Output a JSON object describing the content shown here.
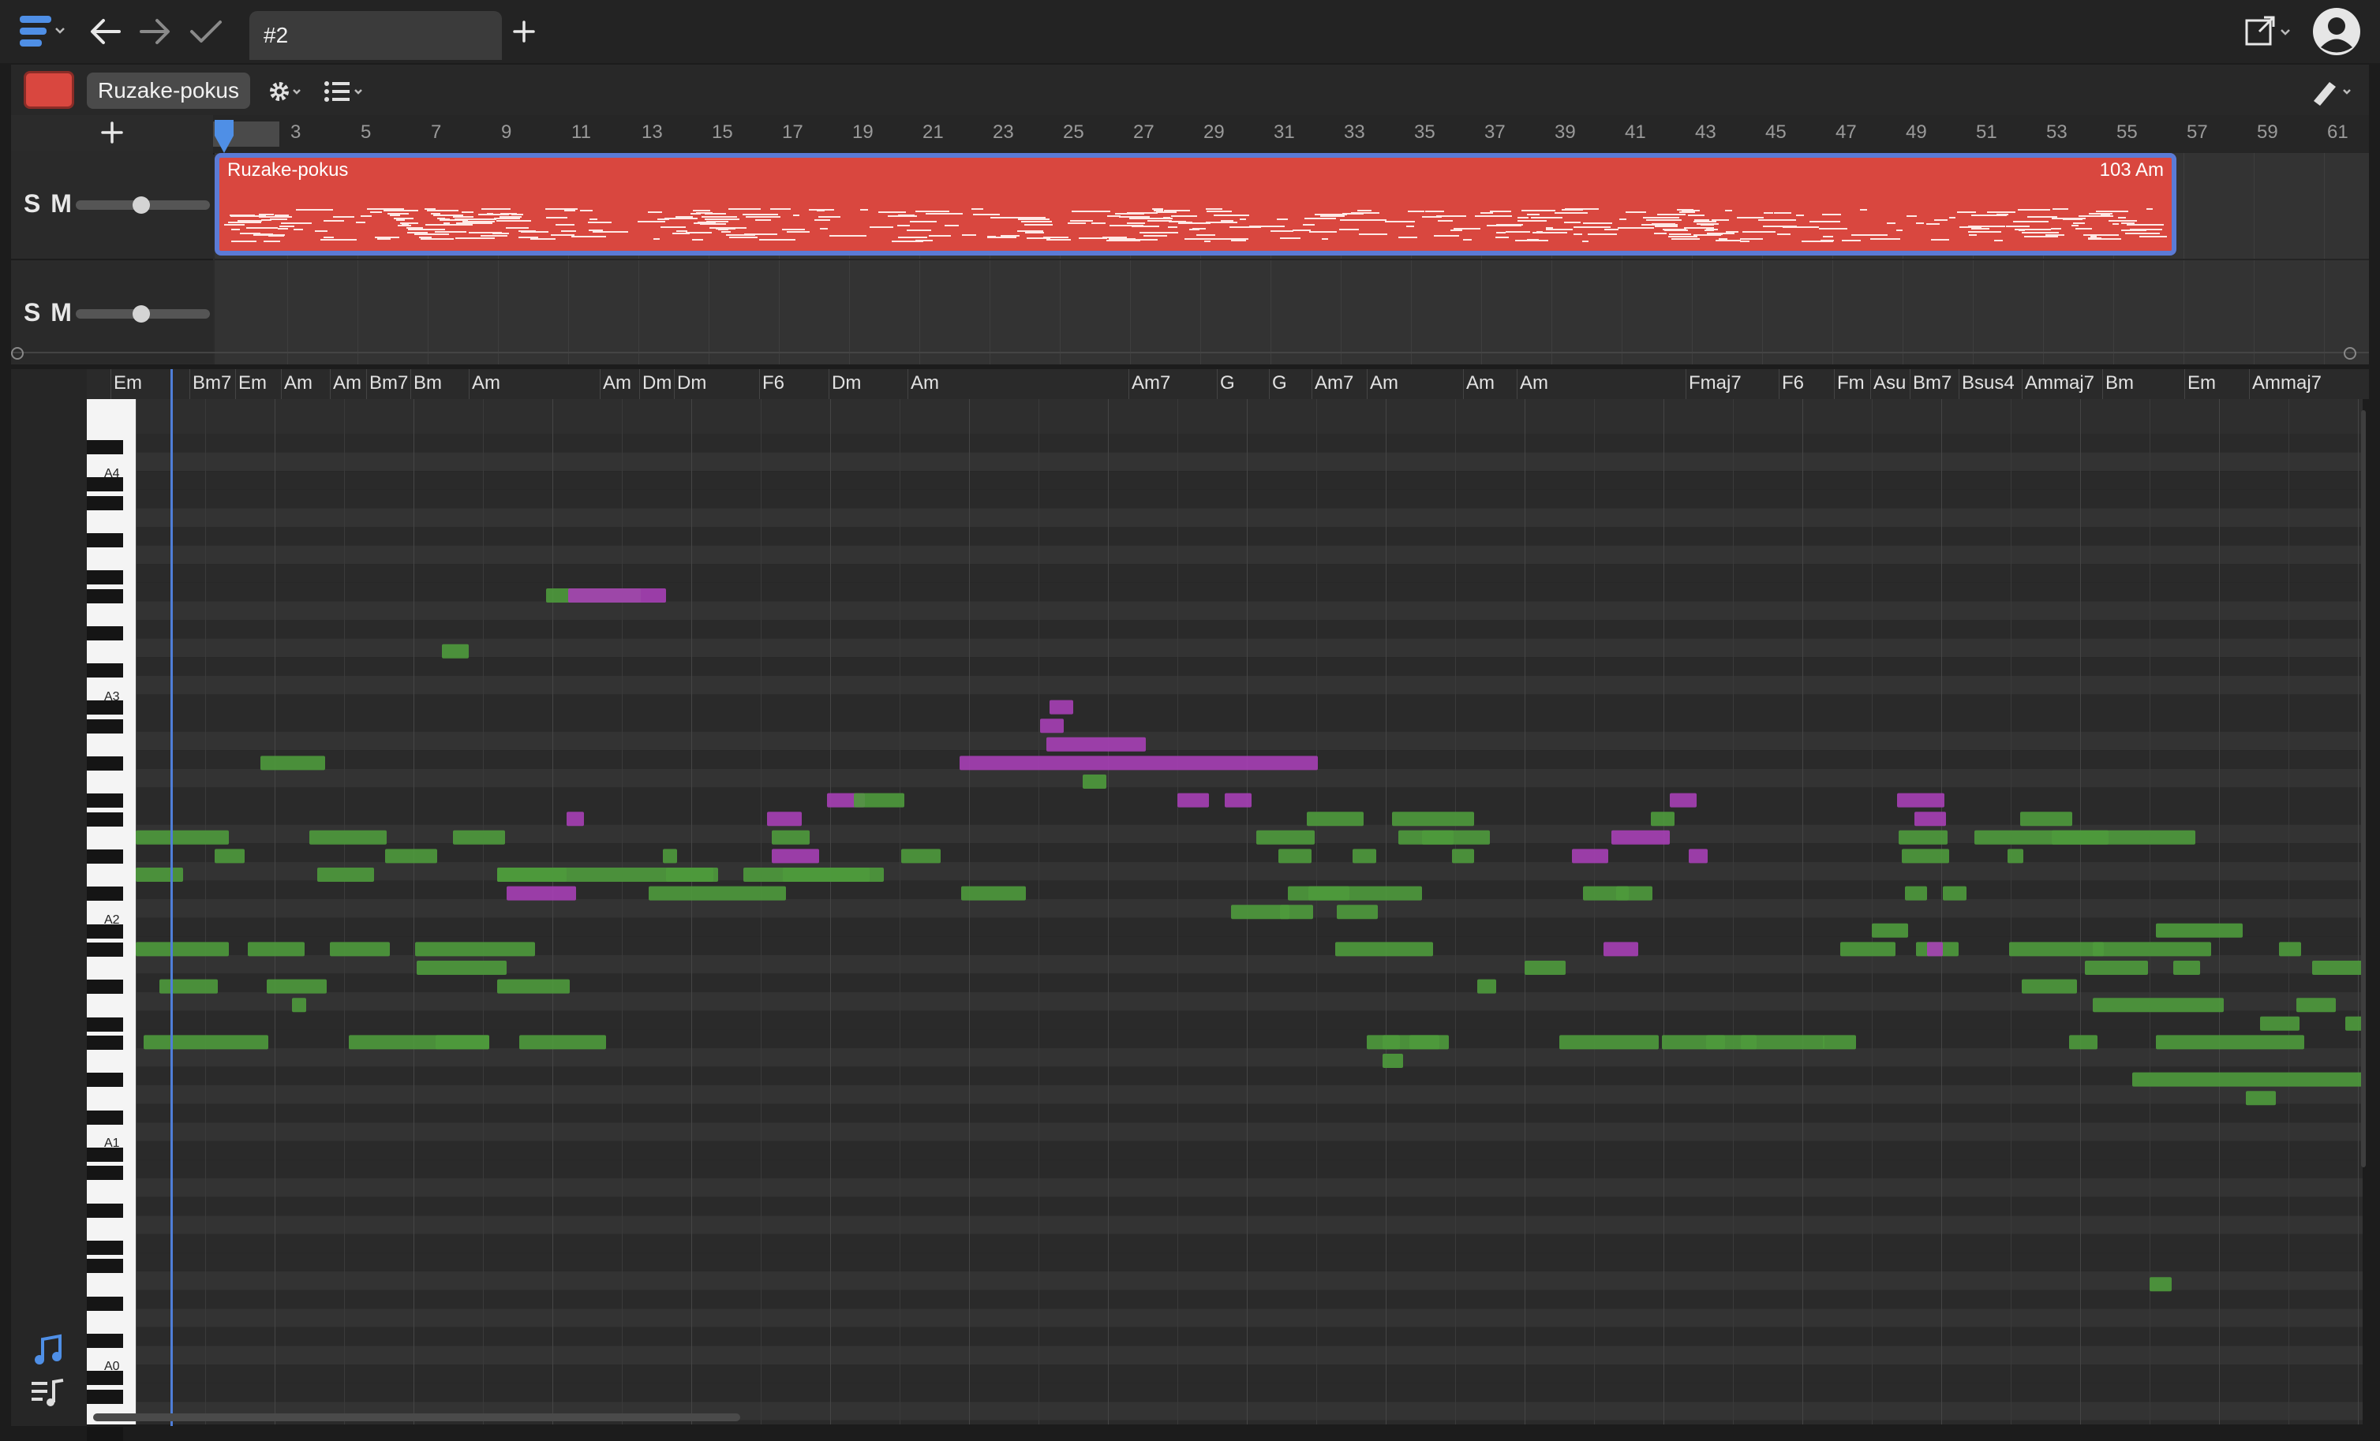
{
  "toolbar": {
    "menu_icon": "hamburger-menu-icon",
    "back_icon": "arrow-left-icon",
    "forward_icon": "arrow-right-icon",
    "apply_icon": "checkmark-icon",
    "tab_label": "#2",
    "add_tab_icon": "plus-icon",
    "export_icon": "external-link-icon",
    "user_icon": "user-avatar-icon"
  },
  "track_bar": {
    "track_color": "#d9473f",
    "track_name": "Ruzake-pokus",
    "settings_icon": "gear-icon",
    "list_icon": "list-icon",
    "tool_icon": "pencil-tool-icon"
  },
  "arrangement": {
    "add_track_icon": "plus-icon",
    "bar_numbers": [
      "3",
      "5",
      "7",
      "9",
      "11",
      "13",
      "15",
      "17",
      "19",
      "21",
      "23",
      "25",
      "27",
      "29",
      "31",
      "33",
      "35",
      "37",
      "39",
      "41",
      "43",
      "45",
      "47",
      "49",
      "51",
      "53",
      "55",
      "57",
      "59",
      "61"
    ],
    "tracks": [
      {
        "solo": "S",
        "mute": "M",
        "volume": 0.7
      },
      {
        "solo": "S",
        "mute": "M",
        "volume": 0.7
      }
    ],
    "clip": {
      "name": "Ruzake-pokus",
      "info": "103 Am",
      "color": "#d9473f"
    }
  },
  "piano_roll": {
    "chords": [
      "Em",
      "Bm7",
      "Em",
      "Am",
      "Am",
      "Bm7",
      "Bm",
      "Am",
      "Am",
      "Dm",
      "Dm",
      "F6",
      "Dm",
      "Am",
      "Am7",
      "G",
      "G",
      "Am7",
      "Am",
      "Am",
      "Am",
      "Fmaj7",
      "F6",
      "Fm",
      "Asu",
      "Bm7",
      "Bsus4",
      "Ammaj7",
      "Bm",
      "Em",
      "Ammaj7"
    ],
    "key_labels": [
      "A4",
      "A3",
      "A2",
      "A1",
      "A0"
    ],
    "note_colors": {
      "green": "#4e9a3c",
      "purple": "#a63fb5"
    },
    "sidebar_icons": [
      "music-note-icon",
      "playlist-icon"
    ]
  }
}
